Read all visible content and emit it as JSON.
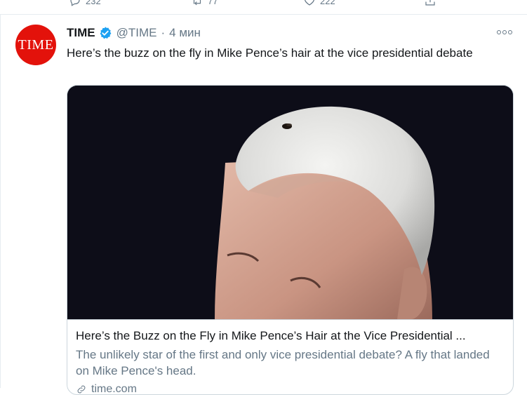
{
  "previous_tweet": {
    "actions": [
      {
        "icon": "reply-icon",
        "count": "232"
      },
      {
        "icon": "retweet-icon",
        "count": "77"
      },
      {
        "icon": "like-icon",
        "count": "222"
      },
      {
        "icon": "share-icon",
        "count": ""
      }
    ]
  },
  "tweet": {
    "avatar_text": "TIME",
    "name": "TIME",
    "handle": "@TIME",
    "separator": "·",
    "time": "4 мин",
    "text": "Here’s the buzz on the fly in Mike Pence’s hair at the vice presidential debate",
    "card": {
      "title": "Here’s the Buzz on the Fly in Mike Pence’s Hair at the Vice Presidential ...",
      "description": "The unlikely star of the first and only vice presidential debate? A fly that landed on Mike Pence's head.",
      "domain": "time.com"
    }
  },
  "colors": {
    "brand_red": "#e3120b",
    "verified_blue": "#1da1f2",
    "secondary_text": "#657786",
    "border": "#e6ecf0"
  }
}
